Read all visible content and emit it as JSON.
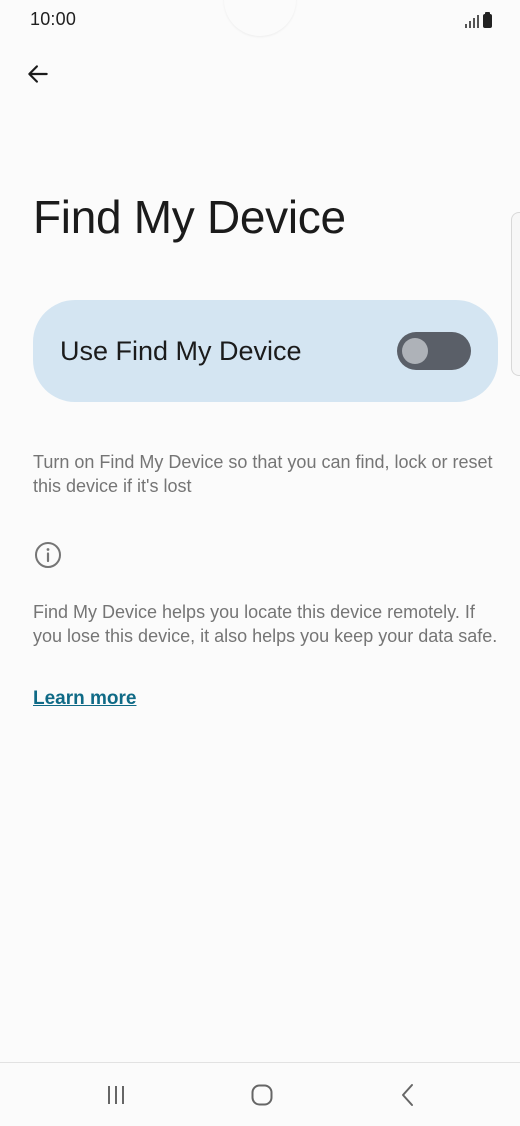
{
  "status_bar": {
    "time": "10:00"
  },
  "page": {
    "title": "Find My Device"
  },
  "toggle": {
    "label": "Use Find My Device",
    "state": "off"
  },
  "description": "Turn on Find My Device so that you can find, lock or reset this device if it's lost",
  "info": {
    "text": "Find My Device helps you locate this device remotely. If you lose this device, it also helps you keep your data safe.",
    "learn_more": "Learn more"
  },
  "colors": {
    "background": "#fbfbfb",
    "card": "#d4e5f2",
    "toggle_track_off": "#5a5f68",
    "link": "#0f6a86",
    "secondary_text": "#757575"
  },
  "icons": {
    "back": "arrow-left-icon",
    "info": "info-circle-icon",
    "signal": "signal-icon",
    "battery": "battery-icon",
    "nav_recents": "recents-icon",
    "nav_home": "home-icon",
    "nav_back": "chevron-left-icon"
  }
}
